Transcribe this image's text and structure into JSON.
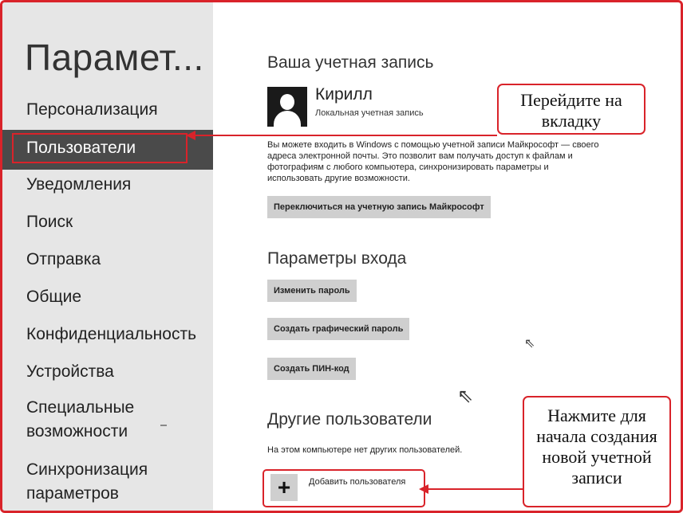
{
  "sidebar": {
    "title": "Парамет...",
    "items": [
      {
        "label": "Персонализация"
      },
      {
        "label": "Пользователи"
      },
      {
        "label": "Уведомления"
      },
      {
        "label": "Поиск"
      },
      {
        "label": "Отправка"
      },
      {
        "label": "Общие"
      },
      {
        "label": "Конфиденциальность"
      },
      {
        "label": "Устройства"
      },
      {
        "label": "Специальные возможности"
      },
      {
        "label": "Синхронизация параметров"
      }
    ],
    "active_index": 1
  },
  "account": {
    "section_title": "Ваша учетная запись",
    "user_name": "Кирилл",
    "user_type": "Локальная учетная запись",
    "description": "Вы можете входить в Windows с помощью учетной записи Майкрософт — своего адреса электронной почты. Это позволит вам получать доступ к файлам и фотографиям с любого компьютера, синхронизировать параметры и использовать другие возможности.",
    "switch_button": "Переключиться на учетную запись Майкрософт"
  },
  "signin": {
    "section_title": "Параметры входа",
    "change_password": "Изменить пароль",
    "picture_password": "Создать графический пароль",
    "pin": "Создать ПИН-код"
  },
  "others": {
    "section_title": "Другие пользователи",
    "none_text": "На этом компьютере нет других пользователей.",
    "add_user": "Добавить пользователя",
    "add_icon": "+"
  },
  "callouts": {
    "tab": "Перейдите на вкладку",
    "add": "Нажмите для начала создания новой учетной записи"
  },
  "colors": {
    "accent_red": "#d9232a",
    "sidebar_bg": "#e6e6e6",
    "active_bg": "#4a4a4a",
    "button_bg": "#cfcfcf"
  }
}
